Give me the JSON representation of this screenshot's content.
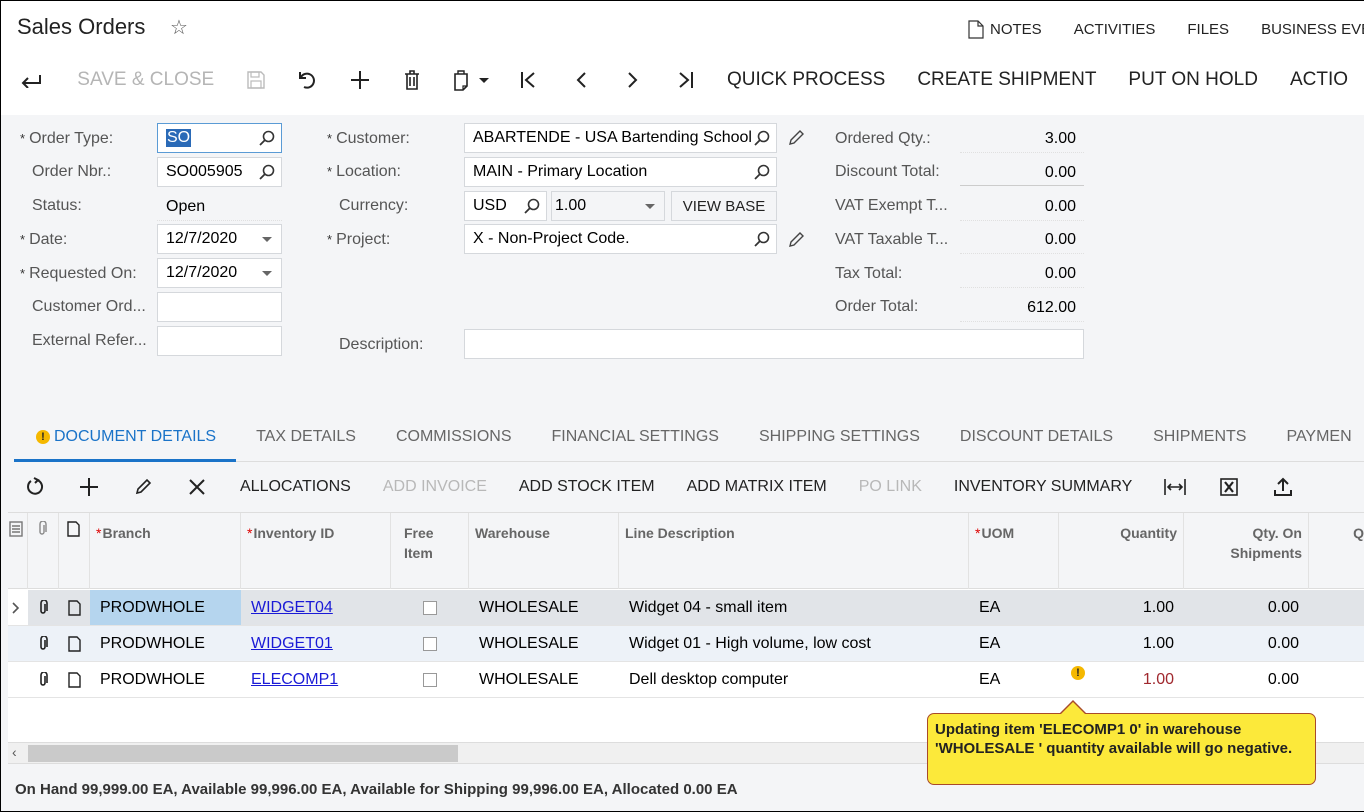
{
  "header": {
    "title": "Sales Orders",
    "links": [
      {
        "label": "NOTES",
        "icon": "note-icon"
      },
      {
        "label": "ACTIVITIES"
      },
      {
        "label": "FILES"
      },
      {
        "label": "BUSINESS EVE"
      }
    ]
  },
  "toolbar": {
    "save_close": "SAVE & CLOSE",
    "quick_process": "QUICK PROCESS",
    "create_shipment": "CREATE SHIPMENT",
    "put_on_hold": "PUT ON HOLD",
    "actions": "ACTIO"
  },
  "form": {
    "order_type": {
      "label": "Order Type:",
      "value": "SO"
    },
    "order_nbr": {
      "label": "Order Nbr.:",
      "value": "SO005905"
    },
    "status": {
      "label": "Status:",
      "value": "Open"
    },
    "date": {
      "label": "Date:",
      "value": "12/7/2020"
    },
    "requested_on": {
      "label": "Requested On:",
      "value": "12/7/2020"
    },
    "customer_ord": {
      "label": "Customer Ord...",
      "value": ""
    },
    "external_ref": {
      "label": "External Refer...",
      "value": ""
    },
    "customer": {
      "label": "Customer:",
      "value": "ABARTENDE - USA Bartending School"
    },
    "location": {
      "label": "Location:",
      "value": "MAIN - Primary Location"
    },
    "currency": {
      "label": "Currency:",
      "value": "USD",
      "rate": "1.00",
      "view_base": "VIEW BASE"
    },
    "project": {
      "label": "Project:",
      "value": "X - Non-Project Code."
    },
    "description": {
      "label": "Description:",
      "value": ""
    },
    "required_mark": "*"
  },
  "totals": [
    {
      "label": "Ordered Qty.:",
      "value": "3.00"
    },
    {
      "label": "Discount Total:",
      "value": "0.00"
    },
    {
      "label": "VAT Exempt T...",
      "value": "0.00"
    },
    {
      "label": "VAT Taxable T...",
      "value": "0.00"
    },
    {
      "label": "Tax Total:",
      "value": "0.00"
    },
    {
      "label": "Order Total:",
      "value": "612.00"
    }
  ],
  "tabs": [
    {
      "label": "DOCUMENT DETAILS",
      "active": true,
      "warning": "!"
    },
    {
      "label": "TAX DETAILS"
    },
    {
      "label": "COMMISSIONS"
    },
    {
      "label": "FINANCIAL SETTINGS"
    },
    {
      "label": "SHIPPING SETTINGS"
    },
    {
      "label": "DISCOUNT DETAILS"
    },
    {
      "label": "SHIPMENTS"
    },
    {
      "label": "PAYMEN"
    }
  ],
  "grid_toolbar": {
    "allocations": "ALLOCATIONS",
    "add_invoice": "ADD INVOICE",
    "add_stock_item": "ADD STOCK ITEM",
    "add_matrix_item": "ADD MATRIX ITEM",
    "po_link": "PO LINK",
    "inventory_summary": "INVENTORY SUMMARY"
  },
  "grid": {
    "columns": {
      "branch": "Branch",
      "inventory_id": "Inventory ID",
      "free_item_1": "Free",
      "free_item_2": "Item",
      "warehouse": "Warehouse",
      "line_description": "Line Description",
      "uom": "UOM",
      "quantity": "Quantity",
      "qty_on_shipments_1": "Qty. On",
      "qty_on_shipments_2": "Shipments",
      "next": "Q"
    },
    "required_mark": "*",
    "rows": [
      {
        "branch": "PRODWHOLE",
        "inventory_id": "WIDGET04",
        "free_item": false,
        "warehouse": "WHOLESALE",
        "description": "Widget 04 - small item",
        "uom": "EA",
        "quantity": "1.00",
        "qty_on_shipments": "0.00"
      },
      {
        "branch": "PRODWHOLE",
        "inventory_id": "WIDGET01",
        "free_item": false,
        "warehouse": "WHOLESALE",
        "description": "Widget 01 - High volume, low cost",
        "uom": "EA",
        "quantity": "1.00",
        "qty_on_shipments": "0.00"
      },
      {
        "branch": "PRODWHOLE",
        "inventory_id": "ELECOMP1",
        "free_item": false,
        "warehouse": "WHOLESALE",
        "description": "Dell desktop computer",
        "uom": "EA",
        "quantity": "1.00",
        "qty_on_shipments": "0.00",
        "warning": "!"
      }
    ]
  },
  "tooltip": "Updating item 'ELECOMP1 0' in warehouse 'WHOLESALE ' quantity available will go negative.",
  "status_bar": "On Hand 99,999.00 EA, Available 99,996.00 EA, Available for Shipping 99,996.00 EA, Allocated 0.00 EA",
  "colors": {
    "accent": "#1a73c8",
    "warning": "#f5b800",
    "tooltip_bg": "#fce93a",
    "negative_qty": "#a0282e",
    "link": "#1a1ad6"
  }
}
